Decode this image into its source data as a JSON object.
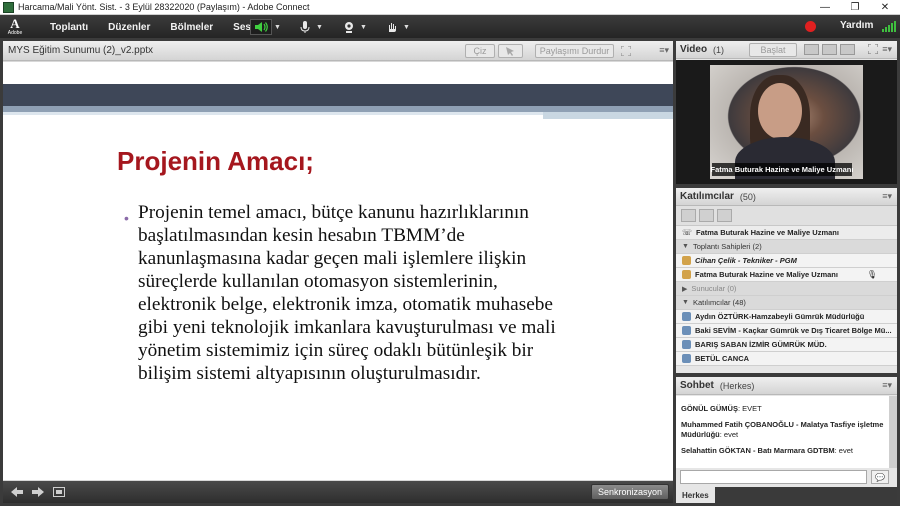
{
  "window": {
    "title": "Harcama/Mali Yönt. Sist. - 3 Eylül 28322020 (Paylaşım) - Adobe Connect",
    "minimize": "—",
    "maximize": "❐",
    "close": "✕"
  },
  "menubar": {
    "logo_letter": "A",
    "logo_text": "Adobe",
    "items": [
      "Toplantı",
      "Düzenler",
      "Bölmeler",
      "Ses"
    ],
    "help": "Yardım",
    "icons": [
      "speaker-icon",
      "microphone-icon",
      "webcam-icon",
      "raise-hand-icon"
    ]
  },
  "share_pod": {
    "title": "MYS Eğitim Sunumu (2)_v2.pptx",
    "draw_label": "Çiz",
    "stop_share_label": "Paylaşımı Durdur",
    "sync_label": "Senkronizasyon"
  },
  "slide": {
    "title": "Projenin Amacı;",
    "bullet": "Projenin temel amacı, bütçe kanunu hazırlıklarının başlatılmasından kesin hesabın TBMM’de kanunlaşmasına kadar geçen mali işlemlere ilişkin süreçlerde kullanılan otomasyon sistemlerinin, elektronik belge, elektronik imza, otomatik muhasebe gibi yeni teknolojik imkanlara kavuşturulması ve mali yönetim sistemimiz için süreç odaklı bütünleşik bir bilişim sistemi altyapısının oluşturulmasıdır."
  },
  "video_pod": {
    "title": "Video",
    "count": "(1)",
    "start_label": "Başlat",
    "caption": "Fatma Buturak Hazine ve Maliye Uzmanı"
  },
  "attendees_pod": {
    "title": "Katılımcılar",
    "count": "(50)",
    "speaking": "Fatma Buturak Hazine ve Maliye Uzmanı",
    "hosts_section": "Toplantı Sahipleri (2)",
    "hosts": [
      "Cihan Çelik - Tekniker - PGM",
      "Fatma Buturak Hazine ve Maliye Uzmanı"
    ],
    "presenters_section": "Sunucular (0)",
    "participants_section": "Katılımcılar (48)",
    "participants": [
      "Aydın ÖZTÜRK-Hamzabeyli Gümrük Müdürlüğü",
      "Baki SEVİM - Kaçkar Gümrük ve Dış Ticaret Bölge Mü...",
      "BARIŞ SABAN İZMİR GÜMRÜK MÜD.",
      "BETÜL CANCA"
    ]
  },
  "chat_pod": {
    "title": "Sohbet",
    "scope": "(Herkes)",
    "messages": [
      {
        "sender": "GÖNÜL GÜMÜŞ",
        "text": ": EVET"
      },
      {
        "sender": "Muhammed Fatih ÇOBANOĞLU - Malatya Tasfiye işletme Müdürlüğü",
        "text": ": evet"
      },
      {
        "sender": "Selahattin GÖKTAN - Batı Marmara GDTBM",
        "text": ": evet"
      }
    ],
    "tab_label": "Herkes"
  }
}
